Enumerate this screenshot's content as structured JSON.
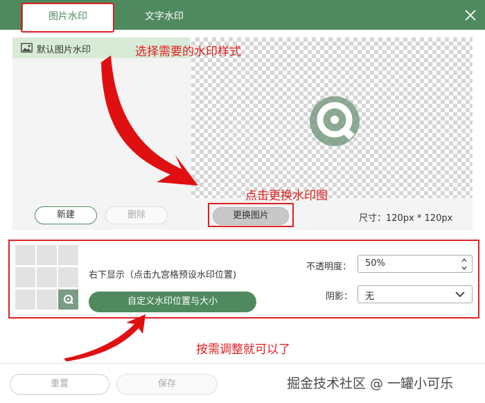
{
  "tabs": [
    {
      "label": "图片水印",
      "active": true
    },
    {
      "label": "文字水印",
      "active": false
    }
  ],
  "list": {
    "items": [
      {
        "label": "默认图片水印",
        "selected": true
      }
    ]
  },
  "buttons": {
    "new_label": "新建",
    "delete_label": "删除",
    "change_image_label": "更换图片",
    "custom_position_label": "自定义水印位置与大小",
    "reset_label": "重置",
    "save_label": "保存"
  },
  "preview": {
    "size_text": "尺寸：120px * 120px"
  },
  "position": {
    "label": "右下显示（点击九宫格预设水印位置)",
    "active_cell": 8
  },
  "opacity": {
    "label": "不透明度：",
    "value": "50%"
  },
  "shadow": {
    "label": "阴影：",
    "value": "无"
  },
  "annotations": {
    "select_style": "选择需要的水印样式",
    "change_image": "点击更换水印图",
    "adjust": "按需调整就可以了"
  },
  "watermark": "掘金技术社区 @ 一罐小可乐",
  "colors": {
    "brand": "#4f8a5f",
    "annotation_red": "#e02020",
    "selected_row": "#d8ebd7"
  },
  "icons": {
    "close": "close-icon",
    "image": "image-icon",
    "logo": "brand-logo-icon",
    "spin_up": "chevron-up-icon",
    "spin_down": "chevron-down-icon",
    "dropdown": "chevron-down-icon"
  }
}
